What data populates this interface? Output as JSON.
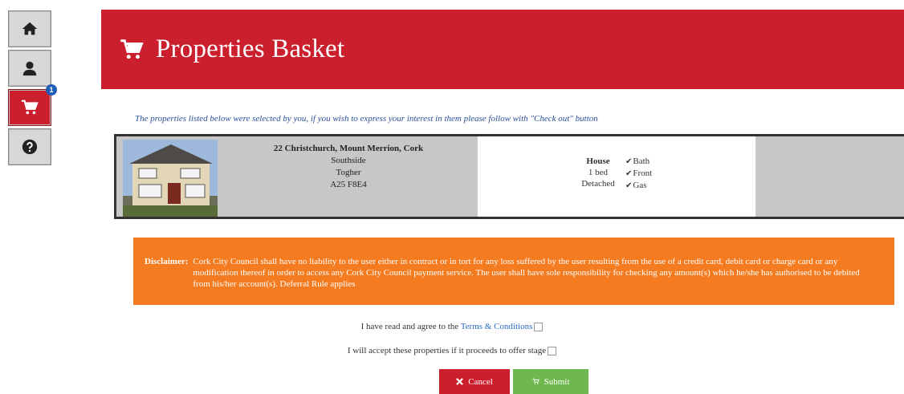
{
  "nav": {
    "items": [
      {
        "icon": "home-icon"
      },
      {
        "icon": "user-icon"
      },
      {
        "icon": "cart-icon",
        "badge": "1",
        "active": true
      },
      {
        "icon": "help-icon"
      }
    ]
  },
  "header": {
    "title": "Properties Basket",
    "icon": "cart-icon"
  },
  "intro": "The properties listed below were selected by you, if you wish to express your interest in them please follow with \"Check out\" button",
  "property": {
    "address": "22 Christchurch, Mount Merrion, Cork",
    "area": "Southside",
    "locality": "Togher",
    "eircode": "A25 F8E4",
    "type": "House",
    "beds": "1 bed",
    "style": "Detached",
    "features": [
      "Bath",
      "Front",
      "Gas"
    ]
  },
  "disclaimer": {
    "label": "Disclaimer:",
    "text": "Cork City Council shall have no liability to the user either in contract or in tort for any loss suffered by the user resulting from the use of a credit card, debit card or charge card or any modification thereof in order to access any Cork City Council payment service. The user shall have sole responsibility for checking any amount(s) which he/she has authorised to be debited from his/her account(s). Deferral Rule applies"
  },
  "agree_terms": {
    "prefix": "I have read and agree to the ",
    "link": "Terms & Conditions"
  },
  "agree_offer": "I will accept these properties if it proceeds to offer stage",
  "buttons": {
    "cancel": "Cancel",
    "submit": "Submit"
  },
  "colors": {
    "brand_red": "#cc1f2e",
    "orange": "#f47b20",
    "green": "#6fb850",
    "badge_blue": "#1f5fb8"
  }
}
